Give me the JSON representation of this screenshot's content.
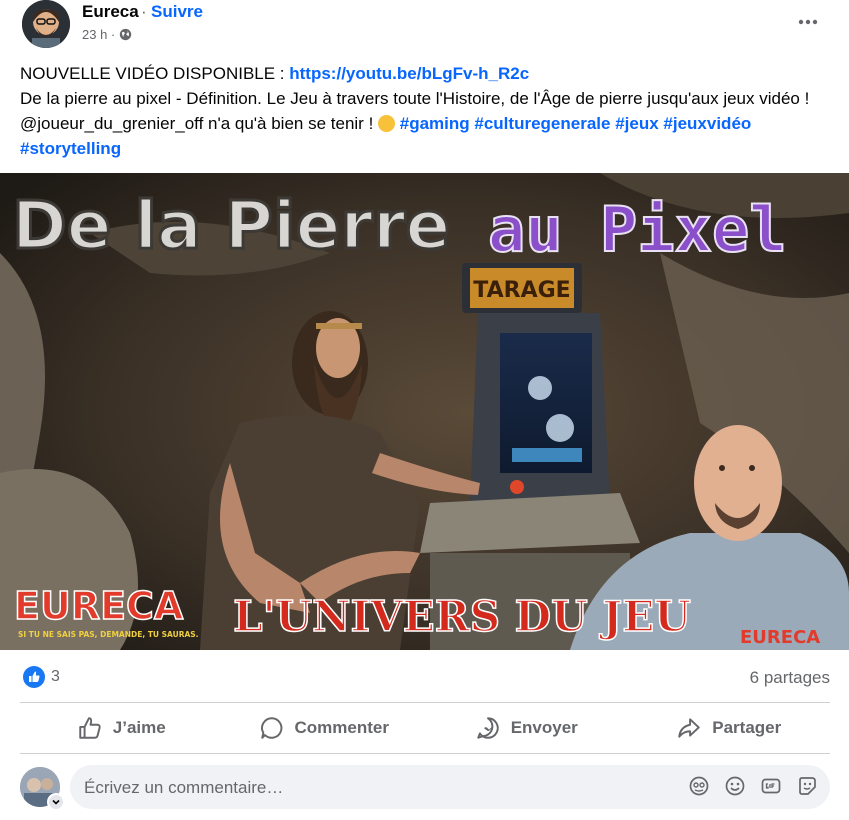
{
  "post": {
    "author": "Eureca",
    "separator": "·",
    "follow_label": "Suivre",
    "time": "23 h ·",
    "text_line1_prefix": "NOUVELLE VIDÉO DISPONIBLE : ",
    "link": "https://youtu.be/bLgFv-h_R2c",
    "text_line2": "De la pierre au pixel - Définition. Le Jeu à travers toute l'Histoire, de l'Âge de pierre jusqu'aux jeux vidéo ! @joueur_du_grenier_off  n'a qu'à bien se tenir ! ",
    "hashtags": [
      "#gaming",
      "#culturegenerale",
      "#jeux",
      "#jeuxvidéo",
      "#storytelling"
    ]
  },
  "thumbnail": {
    "title_left": "De la Pierre",
    "title_right": "au Pixel",
    "arcade_marquee": "TARAGE",
    "logo": "EURECA",
    "logo_tagline": "SI TU NE SAIS PAS, DEMANDE, TU SAURAS.",
    "subtitle": "L'UNIVERS DU JEU",
    "shirt_logo": "EURECA"
  },
  "stats": {
    "reactions_count": "3",
    "shares": "6 partages"
  },
  "actions": {
    "like": "J’aime",
    "comment": "Commenter",
    "send": "Envoyer",
    "share": "Partager"
  },
  "comment": {
    "placeholder": "Écrivez un commentaire…"
  },
  "colors": {
    "accent": "#0866ff",
    "secondary_text": "#65676b",
    "pixel_purple": "#8a4fc9",
    "red_title": "#d42a1e"
  },
  "icons": [
    "globe-icon",
    "more-icon",
    "like-icon",
    "comment-icon",
    "send-icon",
    "share-icon",
    "avatar-icon",
    "sticker-icon",
    "emoji-icon",
    "gif-icon",
    "smile-sticker-icon"
  ]
}
